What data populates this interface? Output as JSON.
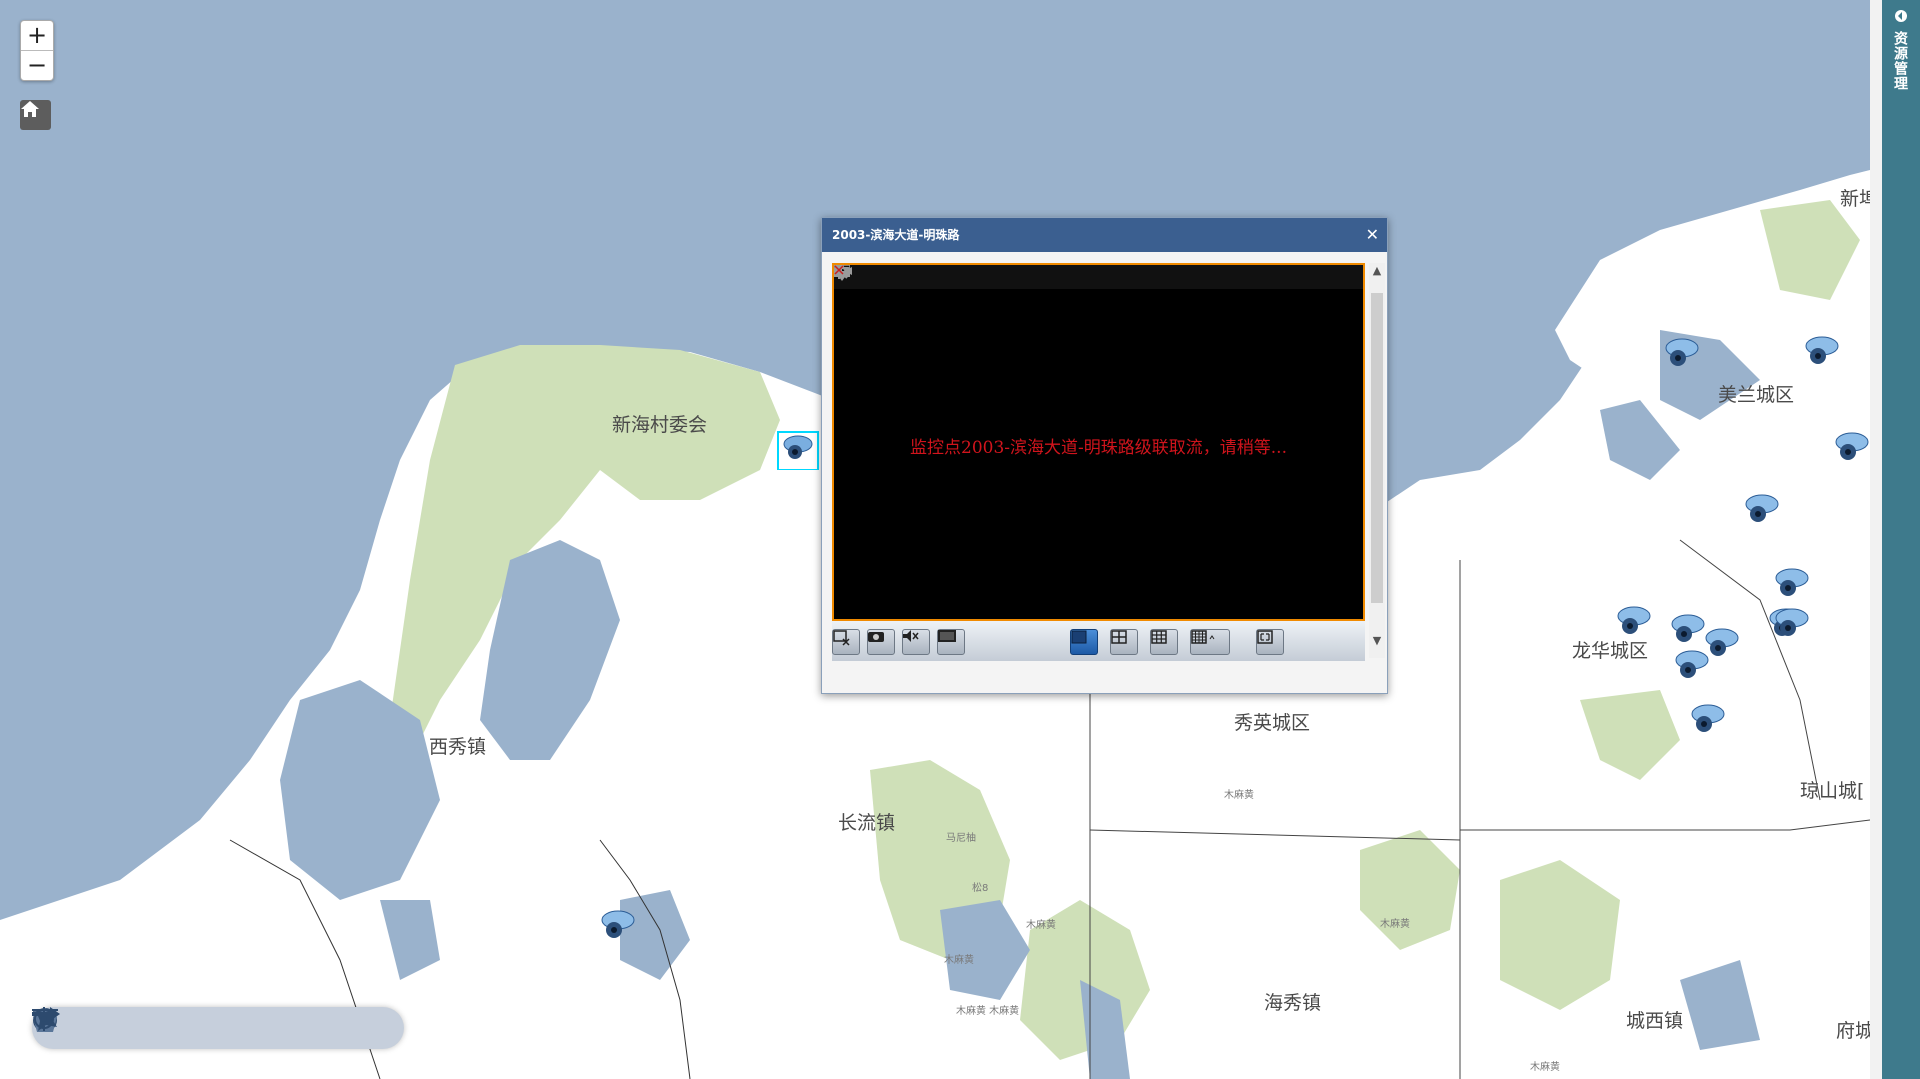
{
  "map": {
    "zoom_in": "+",
    "zoom_out": "−",
    "places": [
      {
        "id": "xinhaicun",
        "label": "新海村委会"
      },
      {
        "id": "meilan",
        "label": "美兰城区"
      },
      {
        "id": "longhua",
        "label": "龙华城区"
      },
      {
        "id": "xiuying",
        "label": "秀英城区"
      },
      {
        "id": "xixiu",
        "label": "西秀镇"
      },
      {
        "id": "changliu",
        "label": "长流镇"
      },
      {
        "id": "haixiu",
        "label": "海秀镇"
      },
      {
        "id": "chengxi",
        "label": "城西镇"
      },
      {
        "id": "qiongshan",
        "label": "琼山城["
      },
      {
        "id": "xinbu",
        "label": "新埠"
      },
      {
        "id": "fucheng",
        "label": "府城"
      }
    ],
    "small_labels": [
      {
        "id": "s1",
        "label": "木麻黄"
      },
      {
        "id": "s2",
        "label": "马尼柚"
      },
      {
        "id": "s3",
        "label": "松8"
      },
      {
        "id": "s4",
        "label": "木麻黄"
      },
      {
        "id": "s5",
        "label": "木麻黄"
      },
      {
        "id": "s6",
        "label": "木麻黄 木麻黄"
      },
      {
        "id": "s7",
        "label": "木麻黄"
      },
      {
        "id": "s8",
        "label": "木麻黄"
      }
    ]
  },
  "toolbar": {
    "tools": [
      "trash-icon",
      "circle-icon",
      "polygon-icon",
      "star-icon",
      "line-icon",
      "arrow-icon",
      "target-icon"
    ]
  },
  "sidebar": {
    "label": "资源管理"
  },
  "popup": {
    "title": "2003-滨海大道-明珠路",
    "close": "✕",
    "message": "监控点2003-滨海大道-明珠路级联取流，请稍等...",
    "top_icons": [
      "record-icon",
      "snapshot-icon",
      "ptz-icon",
      "mute-icon",
      "mic-icon",
      "zoom-icon",
      "window-icon",
      "close-icon"
    ],
    "bottom_left": [
      "stop-all-icon",
      "capture-icon",
      "volume-icon",
      "screen-icon"
    ],
    "layouts": [
      "layout-1x1-icon",
      "layout-2x2-icon",
      "layout-3x3-icon",
      "layout-4x4-icon"
    ],
    "fullscreen": "fullscreen-icon",
    "active_layout": "layout-1x1-icon"
  },
  "colors": {
    "sea": "#9ab2cc",
    "land": "#ffffff",
    "green": "#cfe0b8",
    "water": "#9ab2cc",
    "popup_header": "#3b5f90",
    "video_border": "#f08a00",
    "message": "#d0141c",
    "panel": "#3e7a8c"
  }
}
